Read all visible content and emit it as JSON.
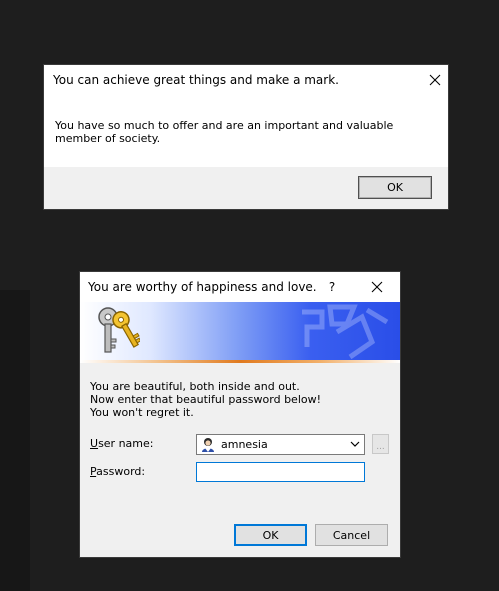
{
  "dialog1": {
    "title": "You can achieve great things and make a mark.",
    "message": "You have so much to offer and are an important and valuable member of society.",
    "ok_label": "OK"
  },
  "dialog2": {
    "title": "You are worthy of happiness and love.",
    "help_label": "?",
    "intro_lines": [
      "You are beautiful, both inside and out.",
      "Now enter that beautiful password below!",
      "You won't regret it."
    ],
    "username_label_accel": "U",
    "username_label_rest": "ser name:",
    "username_value": "amnesia",
    "password_label_accel": "P",
    "password_label_rest": "assword:",
    "password_value": "",
    "browse_label": "...",
    "ok_label": "OK",
    "cancel_label": "Cancel",
    "accent": "#0078d7"
  },
  "icons": {
    "close": "close-icon",
    "help": "help-icon",
    "keys": "keys-icon",
    "user": "user-avatar-icon",
    "chevron": "chevron-down-icon"
  }
}
